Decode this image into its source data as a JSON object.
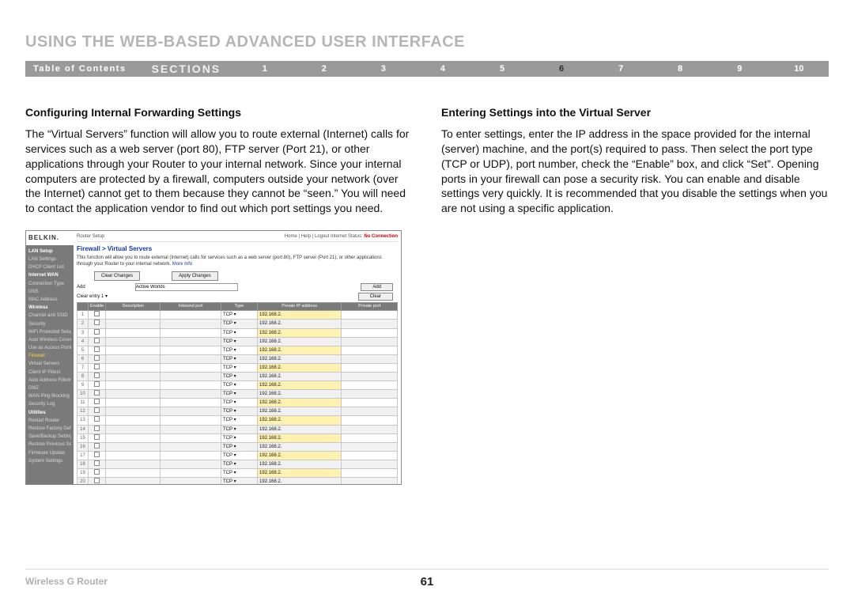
{
  "title": "USING THE WEB-BASED ADVANCED USER INTERFACE",
  "nav": {
    "toc": "Table of Contents",
    "sections": "SECTIONS",
    "items": [
      "1",
      "2",
      "3",
      "4",
      "5",
      "6",
      "7",
      "8",
      "9",
      "10"
    ],
    "active": "6"
  },
  "left": {
    "heading": "Configuring Internal Forwarding Settings",
    "body": "The “Virtual Servers” function will allow you to route external (Internet) calls for services such as a web server (port 80), FTP server (Port 21), or other applications through your Router to your internal network. Since your internal computers are protected by a firewall, computers outside your network (over the Internet) cannot get to them because they cannot be “seen.” You will need to contact the application vendor to find out which port settings you need."
  },
  "right": {
    "heading": "Entering Settings into the Virtual Server",
    "body": "To enter settings, enter the IP address in the space provided for the internal (server) machine, and the port(s) required to pass. Then select the port type (TCP or UDP), port number, check the “Enable” box, and click “Set”. Opening ports in your firewall can pose a security risk. You can enable and disable settings very quickly. It is recommended that you disable the settings when you are not using a specific application."
  },
  "ss": {
    "brand": "BELKIN.",
    "setup": "Router Setup",
    "toplinks": "Home | Help | Logout   Internet Status:",
    "status": "No Connection",
    "side": [
      "LAN Setup",
      "LAN Settings",
      "DHCP Client List",
      "Internet WAN",
      "Connection Type",
      "DNS",
      "MAC Address",
      "Wireless",
      "Channel and SSID",
      "Security",
      "WiFi Protected Setup",
      "Auto Wireless Cover",
      "Use as Access Point",
      "Firewall",
      "Virtual Servers",
      "Client IP Filters",
      "Auto Address Filtering",
      "DMZ",
      "WAN Ping Blocking",
      "Security Log",
      "Utilities",
      "Restart Router",
      "Restore Factory Defaults",
      "Save/Backup Settings",
      "Restore Previous Settings",
      "Firmware Update",
      "System Settings"
    ],
    "h": "Firewall > Virtual Servers",
    "desc": "This function will allow you to route external (Internet) calls for services such as a web server (port 80), FTP server (Port 21), or other applications through your Router to your internal network.",
    "more": "More Info",
    "btn_clear": "Clear Changes",
    "btn_apply": "Apply Changes",
    "add_lbl": "Add",
    "add_val": "Active Worlds",
    "add_btn": "Add",
    "clear_lbl": "Clear entry",
    "clear_val": "1",
    "clear_btn": "Clear",
    "th": [
      "",
      "Enable",
      "Description",
      "Inbound port",
      "Type",
      "Private IP address",
      "Private port"
    ],
    "tcp": "TCP",
    "ip": "192.168.2.",
    "rows": 20
  },
  "footer": {
    "left": "Wireless G Router",
    "page": "61"
  }
}
